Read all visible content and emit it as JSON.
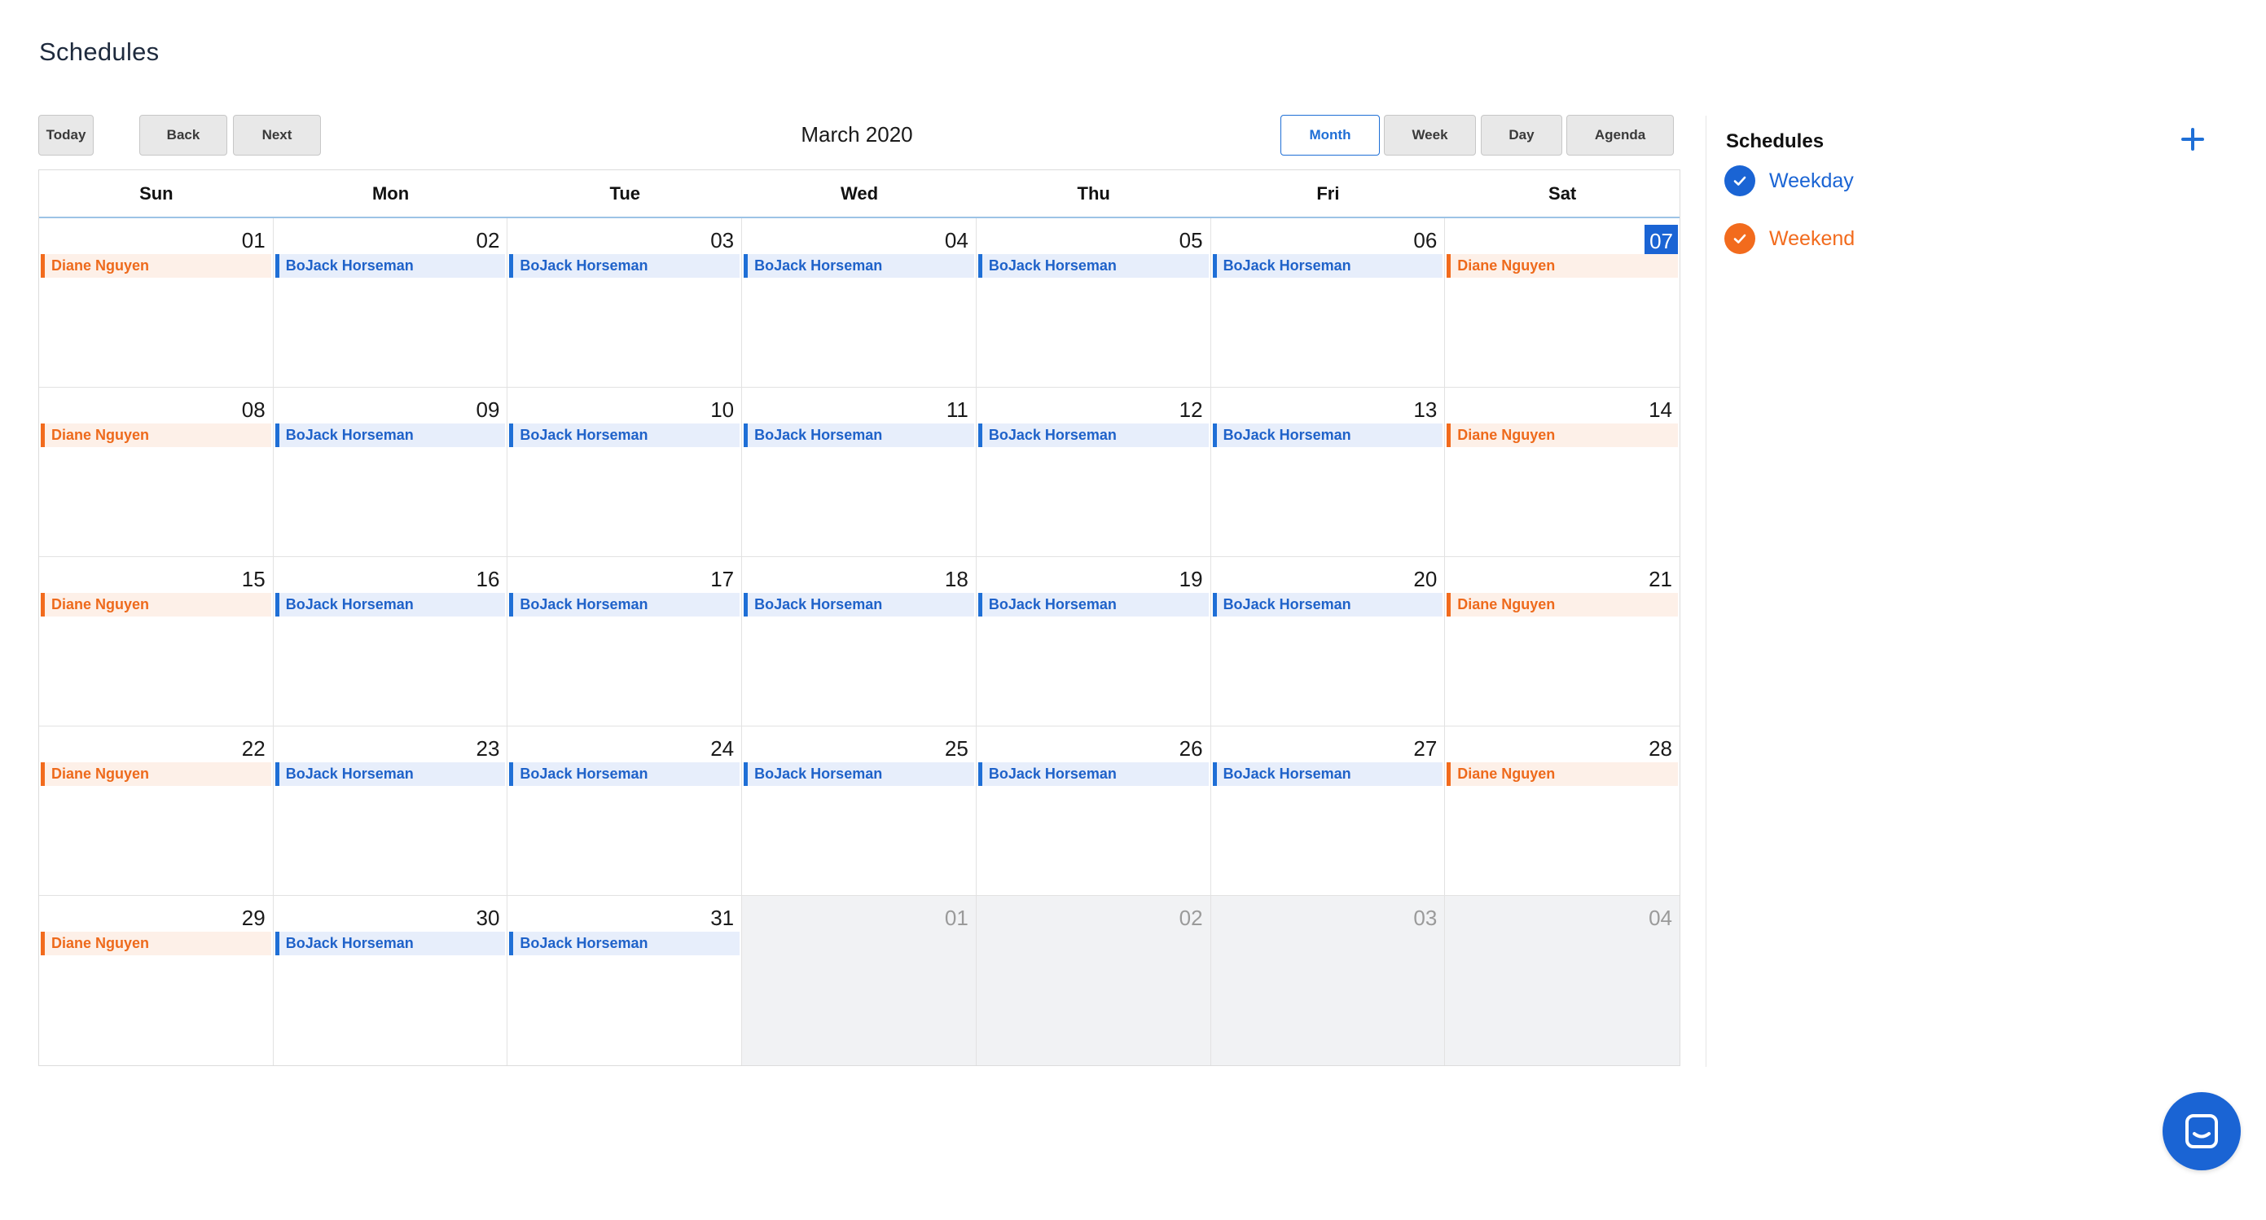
{
  "page": {
    "title": "Schedules"
  },
  "toolbar": {
    "today_label": "Today",
    "back_label": "Back",
    "next_label": "Next",
    "month_label": "March 2020",
    "views": [
      {
        "label": "Month",
        "active": true
      },
      {
        "label": "Week",
        "active": false
      },
      {
        "label": "Day",
        "active": false
      },
      {
        "label": "Agenda",
        "active": false
      }
    ]
  },
  "calendar": {
    "day_headers": [
      "Sun",
      "Mon",
      "Tue",
      "Wed",
      "Thu",
      "Fri",
      "Sat"
    ],
    "today": "07",
    "weeks": [
      [
        {
          "date": "01",
          "event": "Diane Nguyen",
          "type": "weekend"
        },
        {
          "date": "02",
          "event": "BoJack Horseman",
          "type": "weekday"
        },
        {
          "date": "03",
          "event": "BoJack Horseman",
          "type": "weekday"
        },
        {
          "date": "04",
          "event": "BoJack Horseman",
          "type": "weekday"
        },
        {
          "date": "05",
          "event": "BoJack Horseman",
          "type": "weekday"
        },
        {
          "date": "06",
          "event": "BoJack Horseman",
          "type": "weekday"
        },
        {
          "date": "07",
          "event": "Diane Nguyen",
          "type": "weekend"
        }
      ],
      [
        {
          "date": "08",
          "event": "Diane Nguyen",
          "type": "weekend"
        },
        {
          "date": "09",
          "event": "BoJack Horseman",
          "type": "weekday"
        },
        {
          "date": "10",
          "event": "BoJack Horseman",
          "type": "weekday"
        },
        {
          "date": "11",
          "event": "BoJack Horseman",
          "type": "weekday"
        },
        {
          "date": "12",
          "event": "BoJack Horseman",
          "type": "weekday"
        },
        {
          "date": "13",
          "event": "BoJack Horseman",
          "type": "weekday"
        },
        {
          "date": "14",
          "event": "Diane Nguyen",
          "type": "weekend"
        }
      ],
      [
        {
          "date": "15",
          "event": "Diane Nguyen",
          "type": "weekend"
        },
        {
          "date": "16",
          "event": "BoJack Horseman",
          "type": "weekday"
        },
        {
          "date": "17",
          "event": "BoJack Horseman",
          "type": "weekday"
        },
        {
          "date": "18",
          "event": "BoJack Horseman",
          "type": "weekday"
        },
        {
          "date": "19",
          "event": "BoJack Horseman",
          "type": "weekday"
        },
        {
          "date": "20",
          "event": "BoJack Horseman",
          "type": "weekday"
        },
        {
          "date": "21",
          "event": "Diane Nguyen",
          "type": "weekend"
        }
      ],
      [
        {
          "date": "22",
          "event": "Diane Nguyen",
          "type": "weekend"
        },
        {
          "date": "23",
          "event": "BoJack Horseman",
          "type": "weekday"
        },
        {
          "date": "24",
          "event": "BoJack Horseman",
          "type": "weekday"
        },
        {
          "date": "25",
          "event": "BoJack Horseman",
          "type": "weekday"
        },
        {
          "date": "26",
          "event": "BoJack Horseman",
          "type": "weekday"
        },
        {
          "date": "27",
          "event": "BoJack Horseman",
          "type": "weekday"
        },
        {
          "date": "28",
          "event": "Diane Nguyen",
          "type": "weekend"
        }
      ],
      [
        {
          "date": "29",
          "event": "Diane Nguyen",
          "type": "weekend"
        },
        {
          "date": "30",
          "event": "BoJack Horseman",
          "type": "weekday"
        },
        {
          "date": "31",
          "event": "BoJack Horseman",
          "type": "weekday"
        },
        {
          "date": "01",
          "off": true
        },
        {
          "date": "02",
          "off": true
        },
        {
          "date": "03",
          "off": true
        },
        {
          "date": "04",
          "off": true
        }
      ]
    ]
  },
  "sidebar": {
    "title": "Schedules",
    "add_icon": "plus-icon",
    "schedules": [
      {
        "label": "Weekday",
        "color": "#1a64d4",
        "checked": true
      },
      {
        "label": "Weekend",
        "color": "#f26b1d",
        "checked": true
      }
    ]
  },
  "chat": {
    "icon": "chat-bubble-icon",
    "color": "#1a64d4"
  },
  "colors": {
    "accent": "#1f6fd6",
    "weekday_event_bg": "#e7eefb",
    "weekend_event_bg": "#fdf0e8",
    "weekend_accent": "#f26b1d",
    "today_bg": "#1a64d4"
  }
}
